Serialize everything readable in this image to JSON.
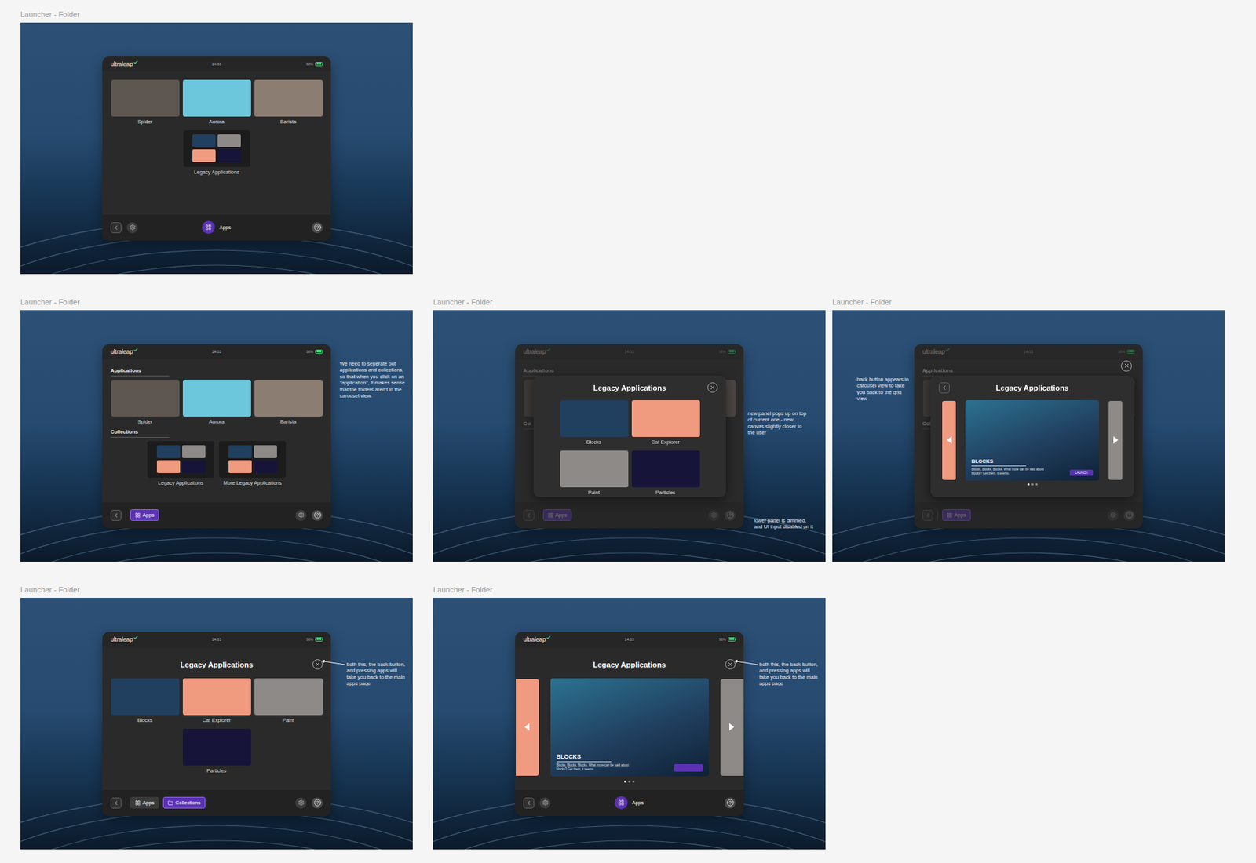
{
  "canvas": {
    "frames": [
      {
        "label": "Launcher - Folder",
        "annotations": [],
        "panel": {
          "header": {
            "logo": "ultraleap",
            "time": "14:03",
            "battery": "98%",
            "battery_level": 0.98
          },
          "dimmed": false,
          "close": false,
          "body": [
            {
              "kind": "tiles",
              "items": [
                {
                  "label": "Spider",
                  "kind": "app",
                  "color": "#5e5650"
                },
                {
                  "label": "Aurora",
                  "kind": "app",
                  "color": "#6cc7dc"
                },
                {
                  "label": "Barista",
                  "kind": "app",
                  "color": "#8b7d72"
                },
                {
                  "label": "Legacy Applications",
                  "kind": "folder",
                  "color": "#1c1c1c"
                }
              ]
            }
          ],
          "nav": {
            "layout": "centered",
            "tabs": [
              {
                "label": "Apps",
                "kind": "apps",
                "selected": true
              }
            ]
          }
        },
        "modal": null
      },
      {
        "label": "Launcher - Folder",
        "annotations": [
          {
            "text": "We need to seperate out applications and collections, so that when you click on an \"application\", it makes sense that the folders aren't in the carousel view.",
            "arrow": false
          }
        ],
        "panel": {
          "header": {
            "logo": "ultraleap",
            "time": "14:03",
            "battery": "98%",
            "battery_level": 0.98
          },
          "dimmed": false,
          "close": false,
          "body": [
            {
              "kind": "section",
              "title": "Applications",
              "items": [
                {
                  "label": "Spider",
                  "kind": "app",
                  "color": "#5e5650"
                },
                {
                  "label": "Aurora",
                  "kind": "app",
                  "color": "#6cc7dc"
                },
                {
                  "label": "Barista",
                  "kind": "app",
                  "color": "#8b7d72"
                }
              ]
            },
            {
              "kind": "section",
              "title": "Collections",
              "items": [
                {
                  "label": "Legacy Applications",
                  "kind": "folder",
                  "color": "#1c1c1c"
                },
                {
                  "label": "More Legacy Applications",
                  "kind": "folder",
                  "color": "#1c1c1c"
                }
              ]
            }
          ],
          "nav": {
            "layout": "split",
            "tabs": [
              {
                "label": "Apps",
                "kind": "apps",
                "selected": true
              }
            ]
          }
        },
        "modal": null
      },
      {
        "label": "Launcher - Folder",
        "annotations": [
          {
            "text": "new panel pops up on top of current one - new canvas slightly closer to the user",
            "arrow": false
          },
          {
            "text": "lower panel is dimmed, and UI input disabled on it",
            "arrow": false
          }
        ],
        "panel": {
          "header": {
            "logo": "ultraleap",
            "time": "14:03",
            "battery": "98%",
            "battery_level": 0.98
          },
          "dimmed": true,
          "close": false,
          "body": [
            {
              "kind": "section",
              "title": "Applications",
              "items": [
                {
                  "kind": "app",
                  "color": "#5e5650"
                },
                {
                  "kind": "app",
                  "color": "#6cc7dc"
                },
                {
                  "kind": "app",
                  "color": "#8b7d72"
                }
              ]
            },
            {
              "kind": "section",
              "title": "Col",
              "items": []
            }
          ],
          "nav": {
            "layout": "split",
            "tabs": [
              {
                "label": "Apps",
                "kind": "apps",
                "selected": true
              }
            ]
          }
        },
        "modal": {
          "blocks": [
            {
              "kind": "title",
              "title": "Legacy Applications",
              "back": false,
              "close": true
            },
            {
              "kind": "tiles",
              "items": [
                {
                  "label": "Blocks",
                  "kind": "app",
                  "color": "#213f5f"
                },
                {
                  "label": "Cat Explorer",
                  "kind": "app",
                  "color": "#f09a80"
                },
                {
                  "label": "Paint",
                  "kind": "app",
                  "color": "#8d8a88"
                },
                {
                  "label": "Particles",
                  "kind": "app",
                  "color": "#17143a"
                }
              ]
            }
          ]
        }
      },
      {
        "label": "Launcher - Folder",
        "annotations": [
          {
            "text": "back button appears in carousel view to take you back to the grid view",
            "arrow": false
          }
        ],
        "panel": {
          "header": {
            "logo": "ultraleap",
            "time": "14:03",
            "battery": "98%",
            "battery_level": 0.98
          },
          "dimmed": true,
          "close": true,
          "body": [
            {
              "kind": "section",
              "title": "Applications",
              "items": [
                {
                  "kind": "app",
                  "color": "#5e5650"
                },
                {
                  "kind": "app",
                  "color": "#6cc7dc"
                },
                {
                  "kind": "app",
                  "color": "#8b7d72"
                }
              ]
            },
            {
              "kind": "section",
              "title": "Col",
              "items": []
            }
          ],
          "nav": {
            "layout": "split",
            "tabs": [
              {
                "label": "Apps",
                "kind": "apps",
                "selected": true
              }
            ]
          }
        },
        "modal": {
          "blocks": [
            {
              "kind": "title",
              "title": "Legacy Applications",
              "back": true,
              "close": false
            },
            {
              "kind": "carousel",
              "prev": {
                "color": "#f09a80"
              },
              "next": {
                "color": "#8d8a88"
              },
              "current": {
                "title": "BLOCKS",
                "description": "Blocks, Blocks, Blocks. What more can be said about blocks? Get them, it seems.",
                "launch": "LAUNCH",
                "color": "#213f5f"
              },
              "pages": [
                {
                  "selected": true
                },
                {
                  "selected": false
                },
                {
                  "selected": false
                }
              ]
            }
          ]
        }
      },
      {
        "label": "Launcher - Folder",
        "annotations": [
          {
            "text": "both this, the back button, and pressing apps will take you back to the main apps page",
            "arrow": true
          }
        ],
        "panel": {
          "header": {
            "logo": "ultraleap",
            "time": "14:03",
            "battery": "98%",
            "battery_level": 0.98
          },
          "dimmed": false,
          "close": false,
          "body": [
            {
              "kind": "title",
              "title": "Legacy Applications",
              "back": false,
              "close": true
            },
            {
              "kind": "tiles",
              "items": [
                {
                  "label": "Blocks",
                  "kind": "app",
                  "color": "#213f5f"
                },
                {
                  "label": "Cat Explorer",
                  "kind": "app",
                  "color": "#f09a80"
                },
                {
                  "label": "Paint",
                  "kind": "app",
                  "color": "#8d8a88"
                },
                {
                  "label": "Particles",
                  "kind": "app",
                  "color": "#17143a"
                }
              ]
            }
          ],
          "nav": {
            "layout": "split",
            "tabs": [
              {
                "label": "Apps",
                "kind": "apps",
                "selected": false
              },
              {
                "label": "Collections",
                "kind": "collections",
                "selected": true
              }
            ]
          }
        },
        "modal": null
      },
      {
        "label": "Launcher - Folder",
        "annotations": [
          {
            "text": "both this, the back button, and pressing apps will take you back to the main apps page",
            "arrow": true
          }
        ],
        "panel": {
          "header": {
            "logo": "ultraleap",
            "time": "14:03",
            "battery": "98%",
            "battery_level": 0.98
          },
          "dimmed": false,
          "close": false,
          "body": [
            {
              "kind": "title",
              "title": "Legacy Applications",
              "back": false,
              "close": true
            },
            {
              "kind": "carousel",
              "prev": {
                "color": "#f09a80"
              },
              "next": {
                "color": "#8d8a88"
              },
              "current": {
                "title": "BLOCKS",
                "description": "Blocks, Blocks, Blocks. What more can be said about blocks? Get them, it seems.",
                "color": "#213f5f"
              },
              "pages": [
                {
                  "selected": true
                },
                {
                  "selected": false
                },
                {
                  "selected": false
                }
              ]
            }
          ],
          "nav": {
            "layout": "centered",
            "tabs": [
              {
                "label": "Apps",
                "kind": "apps",
                "selected": true
              }
            ]
          }
        },
        "modal": null
      }
    ]
  }
}
